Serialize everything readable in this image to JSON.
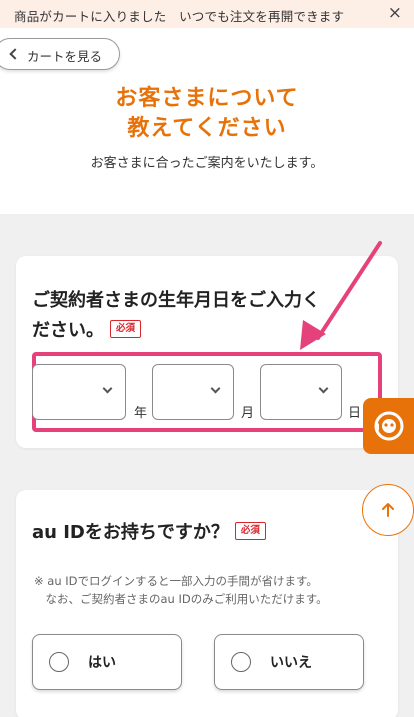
{
  "banner": {
    "text": "商品がカートに入りました　いつでも注文を再開できます",
    "close": "×"
  },
  "header": {
    "back_label": "カートを見る",
    "title_line1": "お客さまについて",
    "title_line2": "教えてください",
    "subtitle": "お客さまに合ったご案内をいたします。"
  },
  "birthdate_card": {
    "question_line1": "ご契約者さまの生年月日をご入力く",
    "question_line2": "ださい。",
    "required": "必須",
    "selects": [
      {
        "unit": "年",
        "value": ""
      },
      {
        "unit": "月",
        "value": ""
      },
      {
        "unit": "日",
        "value": ""
      }
    ]
  },
  "auid_card": {
    "question": "au IDをお持ちですか？",
    "required": "必須",
    "note_line1": "※ au IDでログインすると一部入力の手間が省けます。",
    "note_line2": "　なお、ご契約者さまのau IDのみご利用いただけます。",
    "options": [
      "はい",
      "いいえ"
    ]
  },
  "floating": {
    "chat": "chat-icon",
    "scroll_top": "arrow-up-icon"
  },
  "colors": {
    "accent": "#e8720a",
    "highlight": "#e5417a",
    "required": "#d9262d",
    "background": "#f0f0f0"
  }
}
